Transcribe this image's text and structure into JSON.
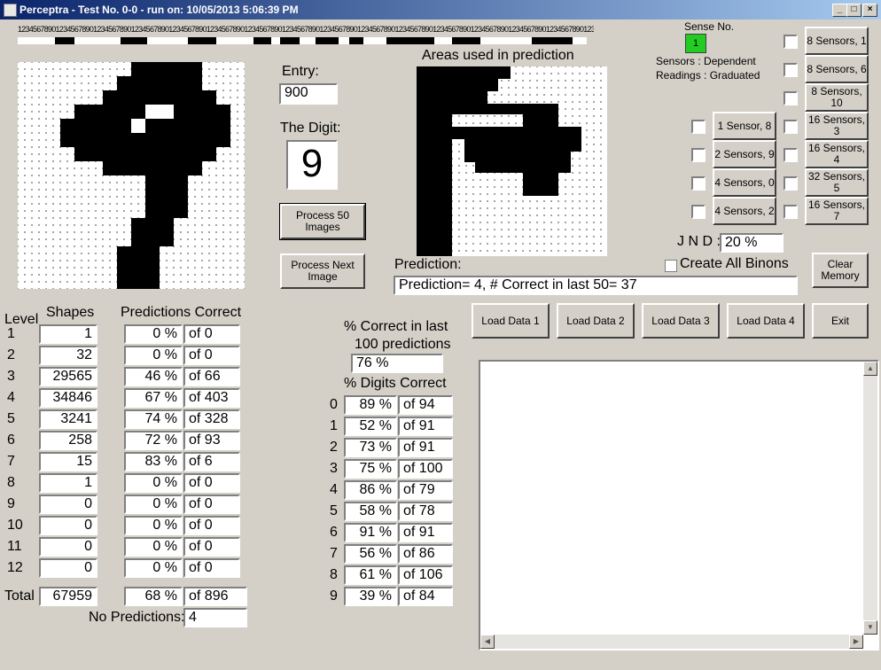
{
  "window": {
    "title": "Perceptra - Test No. 0-0 - run on: 10/05/2013  5:06:39 PM"
  },
  "ruler": "12345678901234567890123456789012345678901234567890123456789012345678901234567890123456789012345678901234567890123456789012345678901234567890123456789012345678",
  "entry": {
    "label": "Entry:",
    "value": "900"
  },
  "digit": {
    "label": "The Digit:",
    "value": "9"
  },
  "areas_label": "Areas used in prediction",
  "buttons": {
    "process50": "Process 50 Images",
    "process_next": "Process Next Image",
    "clear_memory": "Clear Memory",
    "load1": "Load Data 1",
    "load2": "Load Data 2",
    "load3": "Load Data 3",
    "load4": "Load Data 4",
    "exit": "Exit"
  },
  "prediction": {
    "label": "Prediction:",
    "value": "Prediction= 4, # Correct in last 50= 37"
  },
  "sense": {
    "label": "Sense No.",
    "value": "1",
    "indicator_color": "#22cc22"
  },
  "sensors_info": {
    "line1": "Sensors   :  Dependent",
    "line2": "Readings :  Graduated"
  },
  "sensor_buttons_right": [
    "8 Sensors, 1",
    "8 Sensors, 6",
    "8 Sensors, 10",
    "16 Sensors, 3",
    "16 Sensors, 4",
    "32 Sensors, 5",
    "16 Sensors, 7"
  ],
  "sensor_buttons_mid": [
    "1 Sensor, 8",
    "2 Sensors, 9",
    "4 Sensors, 0",
    "4 Sensors, 2"
  ],
  "jnd": {
    "label": "J N D :",
    "value": "20 %"
  },
  "create_all_binons": "Create All Binons",
  "levels": {
    "header_level": "Level",
    "header_shapes": "Shapes",
    "header_pred": "Predictions Correct",
    "rows": [
      {
        "level": "1",
        "shapes": "1",
        "pct": "0 %",
        "of": "of 0"
      },
      {
        "level": "2",
        "shapes": "32",
        "pct": "0 %",
        "of": "of 0"
      },
      {
        "level": "3",
        "shapes": "29565",
        "pct": "46 %",
        "of": "of 66"
      },
      {
        "level": "4",
        "shapes": "34846",
        "pct": "67 %",
        "of": "of 403"
      },
      {
        "level": "5",
        "shapes": "3241",
        "pct": "74 %",
        "of": "of 328"
      },
      {
        "level": "6",
        "shapes": "258",
        "pct": "72 %",
        "of": "of 93"
      },
      {
        "level": "7",
        "shapes": "15",
        "pct": "83 %",
        "of": "of 6"
      },
      {
        "level": "8",
        "shapes": "1",
        "pct": "0 %",
        "of": "of 0"
      },
      {
        "level": "9",
        "shapes": "0",
        "pct": "0 %",
        "of": "of 0"
      },
      {
        "level": "10",
        "shapes": "0",
        "pct": "0 %",
        "of": "of 0"
      },
      {
        "level": "11",
        "shapes": "0",
        "pct": "0 %",
        "of": "of 0"
      },
      {
        "level": "12",
        "shapes": "0",
        "pct": "0 %",
        "of": "of 0"
      }
    ],
    "total_label": "Total",
    "total_shapes": "67959",
    "total_pct": "68 %",
    "total_of": "of 896",
    "no_pred_label": "No Predictions:",
    "no_pred_value": "4"
  },
  "pct_last100": {
    "label1": "% Correct in last",
    "label2": "100 predictions",
    "value": "76 %"
  },
  "digits_correct": {
    "label": "% Digits Correct",
    "rows": [
      {
        "d": "0",
        "pct": "89 %",
        "of": "of 94"
      },
      {
        "d": "1",
        "pct": "52 %",
        "of": "of 91"
      },
      {
        "d": "2",
        "pct": "73 %",
        "of": "of 91"
      },
      {
        "d": "3",
        "pct": "75 %",
        "of": "of 100"
      },
      {
        "d": "4",
        "pct": "86 %",
        "of": "of 79"
      },
      {
        "d": "5",
        "pct": "58 %",
        "of": "of 78"
      },
      {
        "d": "6",
        "pct": "91 %",
        "of": "of 91"
      },
      {
        "d": "7",
        "pct": "56 %",
        "of": "of 86"
      },
      {
        "d": "8",
        "pct": "61 %",
        "of": "of 106"
      },
      {
        "d": "9",
        "pct": "39 %",
        "of": "of 84"
      }
    ]
  }
}
